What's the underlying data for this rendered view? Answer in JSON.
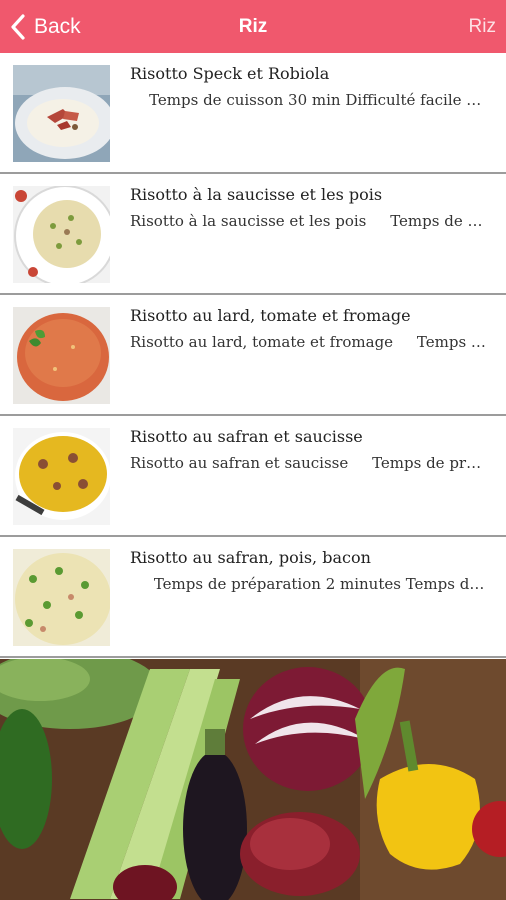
{
  "navbar": {
    "back_label": "Back",
    "title": "Riz",
    "right_label": "Riz"
  },
  "recipes": [
    {
      "title": "Risotto Speck et Robiola",
      "description": "    Temps de cuisson 30 min Difficulté facile S…",
      "image": "risotto-speck-robiola-photo"
    },
    {
      "title": "Risotto à la saucisse et les pois",
      "description": "Risotto à la saucisse et les pois     Temps de c…",
      "image": "risotto-saucisse-pois-photo"
    },
    {
      "title": "Risotto au lard, tomate et fromage",
      "description": "Risotto au lard, tomate et fromage     Temps …",
      "image": "risotto-lard-tomate-photo"
    },
    {
      "title": "Risotto au safran et saucisse",
      "description": "Risotto au safran et saucisse     Temps de pré…",
      "image": "risotto-safran-saucisse-photo"
    },
    {
      "title": "Risotto au safran, pois, bacon",
      "description": "     Temps de préparation 2 minutes Temps d…",
      "image": "risotto-safran-pois-bacon-photo"
    }
  ],
  "footer_image": "vegetables-background-photo",
  "colors": {
    "navbar": "#f0586d",
    "divider": "#9c9c9c"
  }
}
